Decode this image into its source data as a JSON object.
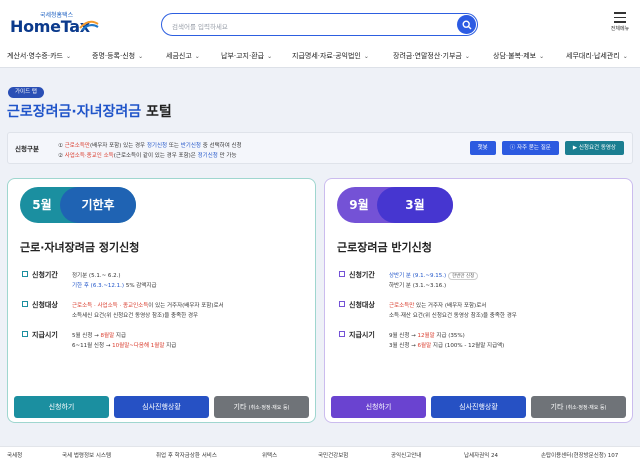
{
  "header": {
    "logo_sub": "국세청홈택스",
    "logo_main": "HomeTax",
    "search_placeholder": "검색어를 입력하세요",
    "menu_label": "전체메뉴"
  },
  "nav": [
    "계산서·영수증·카드",
    "증명·등록·신청",
    "세금신고",
    "납부·고지·환급",
    "지급명세·자료·공익법인",
    "장려금·연말정산·기부금",
    "상담·불복·제보",
    "세무대리·납세관리"
  ],
  "title": {
    "badge": "가이드 탭",
    "accent": "근로장려금·자녀장려금",
    "suffix": "포털"
  },
  "info": {
    "label": "신청구분",
    "line1": {
      "p1": "① ",
      "red1": "근로소득만",
      "p2": "(배우자 포함) 있는 경우 ",
      "blue1": "정기신청",
      "p3": " 또는 ",
      "blue2": "반기신청",
      "p4": " 중 선택하여 신청"
    },
    "line2": {
      "p1": "② ",
      "red1": "사업소득·종교인 소득",
      "p2": "(근로소득이 같이 있는 경우 포함)은 ",
      "blue1": "정기신청",
      "p3": " 만 가능"
    },
    "buttons": [
      "챗봇",
      "자주 묻는 질문",
      "신청요건 동영상"
    ]
  },
  "cards": [
    {
      "month1": "5월",
      "month2": "기한후",
      "title": "근로·자녀장려금 정기신청",
      "period_label": "신청기간",
      "period_line1": "정기분 (5.1.~ 6.2.)",
      "period_line2a": "기한 후 (6.3.~12.1.)",
      "period_line2b": " 5% 감액지급",
      "target_label": "신청대상",
      "target_line1a": "근로소득 · 사업소득 · 종교인소득",
      "target_line1b": "이 있는 거주자(배우자 포함)로서",
      "target_line2": "소득세신 요건(위 신청요건 동영상 참조)을 충족한 경우",
      "pay_label": "지급시기",
      "pay_line1a": "5월 신청 → ",
      "pay_line1b": "8월말",
      "pay_line1c": " 지급",
      "pay_line2a": "6~11월 신청 → ",
      "pay_line2b": "10월말~다음해 1월말",
      "pay_line2c": " 지급",
      "btn1": "신청하기",
      "btn2": "심사진행상황",
      "btn3": "기타",
      "btn3_sub": "(취소·정정·재요 등)"
    },
    {
      "month1": "9월",
      "month2": "3월",
      "title": "근로장려금 반기신청",
      "period_label": "신청기간",
      "period_line1": "상반기 분 (9.1.~9.15.)",
      "period_tag": "한번만 신청",
      "period_line2": "하반기 분 (3.1.~3.16.)",
      "target_label": "신청대상",
      "target_line1a": "근로소득만",
      "target_line1b": " 있는 거주자 (배우자 포함)로서",
      "target_line2": "소득·재산 요건(위 신청요건 동영상 참조)을 충족한 경우",
      "pay_label": "지급시기",
      "pay_line1a": "9월 신청 → ",
      "pay_line1b": "12월말",
      "pay_line1c": " 지급 (35%)",
      "pay_line2a": "3월 신청 → ",
      "pay_line2b": "6월말",
      "pay_line2c": " 지급 (100% - 12월말 지급액)",
      "btn1": "신청하기",
      "btn2": "심사진행상황",
      "btn3": "기타",
      "btn3_sub": "(취소·정정·재요 등)"
    }
  ],
  "footer": [
    "국세청",
    "국세 법령정보 시스템",
    "취업 후 학자금상환 서비스",
    "위택스",
    "국민건강보험",
    "공익신고안내",
    "납세자권익 24",
    "손탑이용센터(현장방문신청) 107"
  ]
}
